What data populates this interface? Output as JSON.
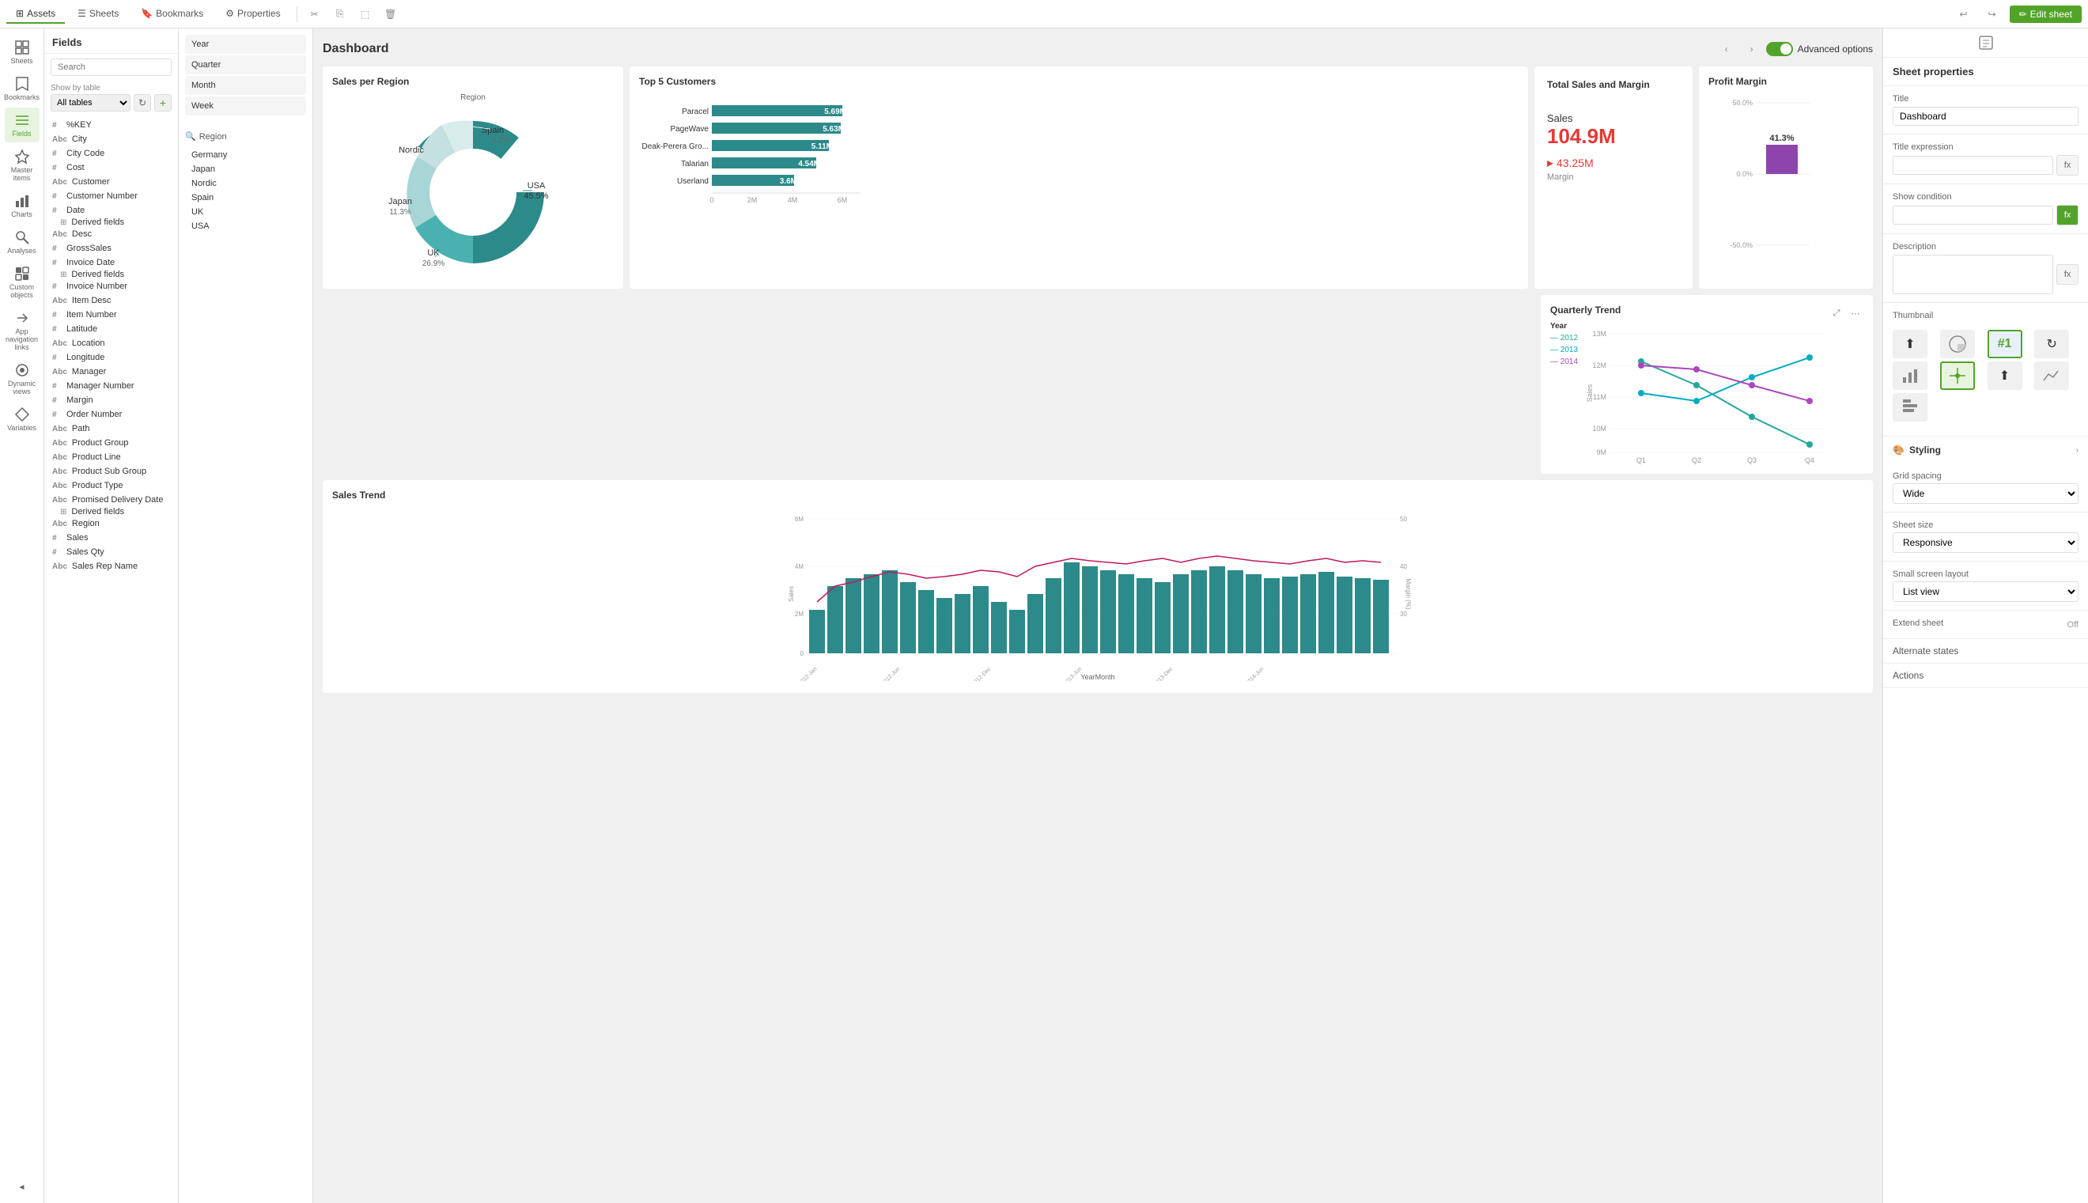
{
  "topbar": {
    "tabs": [
      {
        "id": "assets",
        "label": "Assets",
        "icon": "⊞",
        "active": true
      },
      {
        "id": "sheets",
        "label": "Sheets",
        "icon": "☰"
      },
      {
        "id": "bookmarks",
        "label": "Bookmarks",
        "icon": "🔖"
      },
      {
        "id": "properties",
        "label": "Properties",
        "icon": "⚙"
      }
    ],
    "edit_sheet": "Edit sheet",
    "undo_icon": "↩",
    "redo_icon": "↪"
  },
  "left_nav": {
    "items": [
      {
        "id": "sheets",
        "label": "Sheets",
        "icon": "▦"
      },
      {
        "id": "bookmarks",
        "label": "Bookmarks",
        "icon": "🔖"
      },
      {
        "id": "fields",
        "label": "Fields",
        "icon": "☰",
        "active": true
      },
      {
        "id": "master-items",
        "label": "Master items",
        "icon": "⭐"
      },
      {
        "id": "charts",
        "label": "Charts",
        "icon": "📊"
      },
      {
        "id": "analyses",
        "label": "Analyses",
        "icon": "🔍"
      },
      {
        "id": "custom-objects",
        "label": "Custom objects",
        "icon": "🧩"
      },
      {
        "id": "app-nav",
        "label": "App navigation links",
        "icon": "🔗"
      },
      {
        "id": "dynamic-views",
        "label": "Dynamic views",
        "icon": "◈"
      },
      {
        "id": "variables",
        "label": "Variables",
        "icon": "⬡"
      }
    ],
    "collapse_icon": "◄"
  },
  "fields_panel": {
    "title": "Fields",
    "search_placeholder": "Search",
    "show_by_table_label": "Show by table",
    "show_by_table_value": "All tables",
    "fields": [
      {
        "type": "#",
        "name": "%KEY"
      },
      {
        "type": "Abc",
        "name": "City"
      },
      {
        "type": "#",
        "name": "City Code"
      },
      {
        "type": "#",
        "name": "Cost"
      },
      {
        "type": "Abc",
        "name": "Customer"
      },
      {
        "type": "#",
        "name": "Customer Number"
      },
      {
        "type": "#",
        "name": "Date",
        "has_derived": true
      },
      {
        "type": "Abc",
        "name": "Desc"
      },
      {
        "type": "#",
        "name": "GrossSales"
      },
      {
        "type": "#",
        "name": "Invoice Date",
        "has_derived": true
      },
      {
        "type": "#",
        "name": "Invoice Number"
      },
      {
        "type": "Abc",
        "name": "Item Desc"
      },
      {
        "type": "#",
        "name": "Item Number"
      },
      {
        "type": "#",
        "name": "Latitude"
      },
      {
        "type": "Abc",
        "name": "Location"
      },
      {
        "type": "#",
        "name": "Longitude"
      },
      {
        "type": "Abc",
        "name": "Manager"
      },
      {
        "type": "#",
        "name": "Manager Number"
      },
      {
        "type": "#",
        "name": "Margin"
      },
      {
        "type": "#",
        "name": "Order Number"
      },
      {
        "type": "Abc",
        "name": "Path"
      },
      {
        "type": "Abc",
        "name": "Product Group"
      },
      {
        "type": "Abc",
        "name": "Product Line"
      },
      {
        "type": "Abc",
        "name": "Product Sub Group"
      },
      {
        "type": "Abc",
        "name": "Product Type"
      },
      {
        "type": "Abc",
        "name": "Promised Delivery Date",
        "has_derived": true
      },
      {
        "type": "Abc",
        "name": "Region"
      },
      {
        "type": "#",
        "name": "Sales"
      },
      {
        "type": "#",
        "name": "Sales Qty"
      },
      {
        "type": "Abc",
        "name": "Sales Rep Name"
      }
    ],
    "derived_label": "Derived fields"
  },
  "filter_panel": {
    "filters": [
      "Year",
      "Quarter",
      "Month",
      "Week"
    ],
    "region_label": "Region",
    "regions": [
      "Germany",
      "Japan",
      "Nordic",
      "Spain",
      "UK",
      "USA"
    ]
  },
  "dashboard": {
    "title": "Dashboard",
    "advanced_options": "Advanced options"
  },
  "charts": {
    "sales_per_region": {
      "title": "Sales per Region",
      "legend_label": "Region",
      "segments": [
        {
          "label": "USA",
          "value": 45.5,
          "color": "#2d8a8a"
        },
        {
          "label": "UK",
          "value": 26.9,
          "color": "#4ab0b0"
        },
        {
          "label": "Japan",
          "value": 11.3,
          "color": "#a8d5d5"
        },
        {
          "label": "Nordic",
          "value": 9.9,
          "color": "#c5e0e0"
        },
        {
          "label": "Spain",
          "value": 3.2,
          "color": "#d8ecec"
        }
      ]
    },
    "top5_customers": {
      "title": "Top 5 Customers",
      "customers": [
        {
          "name": "Paracel",
          "value": "5.69M",
          "pct": 95
        },
        {
          "name": "PageWave",
          "value": "5.63M",
          "pct": 93
        },
        {
          "name": "Deak-Perera Gro...",
          "value": "5.11M",
          "pct": 85
        },
        {
          "name": "Talarian",
          "value": "4.54M",
          "pct": 75
        },
        {
          "name": "Userland",
          "value": "3.6M",
          "pct": 60
        }
      ],
      "axis": [
        "0",
        "2M",
        "4M",
        "6M"
      ]
    },
    "total_sales_margin": {
      "title": "Total Sales and Margin",
      "sales_label": "Sales",
      "sales_value": "104.9M",
      "margin_value": "43.25M",
      "margin_label": "Margin",
      "arrow": "▸"
    },
    "profit_margin": {
      "title": "Profit Margin",
      "value": "41.3%",
      "y_max": "50.0%",
      "y_mid": "0.0%",
      "y_min": "-50.0%"
    },
    "quarterly_trend": {
      "title": "Quarterly Trend",
      "y_labels": [
        "9M",
        "10M",
        "11M",
        "12M",
        "13M"
      ],
      "x_labels": [
        "Q1",
        "Q2",
        "Q3",
        "Q4"
      ],
      "legend": [
        {
          "year": "2012",
          "color": "#26a69a"
        },
        {
          "year": "2013",
          "color": "#00acc1"
        },
        {
          "year": "2014",
          "color": "#ab47bc"
        }
      ],
      "sales_label": "Sales",
      "year_label": "Year"
    },
    "sales_trend": {
      "title": "Sales Trend",
      "x_label": "YearMonth",
      "y_left_label": "Sales",
      "y_right_label": "Margin (%)",
      "y_left": [
        "0",
        "2M",
        "4M",
        "6M"
      ],
      "y_right": [
        "30",
        "40",
        "50"
      ],
      "bar_color": "#2d8a8a",
      "line_color": "#c2185b"
    }
  },
  "right_panel": {
    "title": "Sheet properties",
    "title_label": "Title",
    "title_value": "Dashboard",
    "title_expression_label": "Title expression",
    "show_condition_label": "Show condition",
    "description_label": "Description",
    "thumbnail_label": "Thumbnail",
    "styling_label": "Styling",
    "grid_spacing_label": "Grid spacing",
    "grid_spacing_value": "Wide",
    "sheet_size_label": "Sheet size",
    "sheet_size_value": "Responsive",
    "small_screen_label": "Small screen layout",
    "small_screen_value": "List view",
    "extend_sheet_label": "Extend sheet",
    "extend_sheet_value": "Off",
    "alternate_states_label": "Alternate states",
    "actions_label": "Actions"
  }
}
